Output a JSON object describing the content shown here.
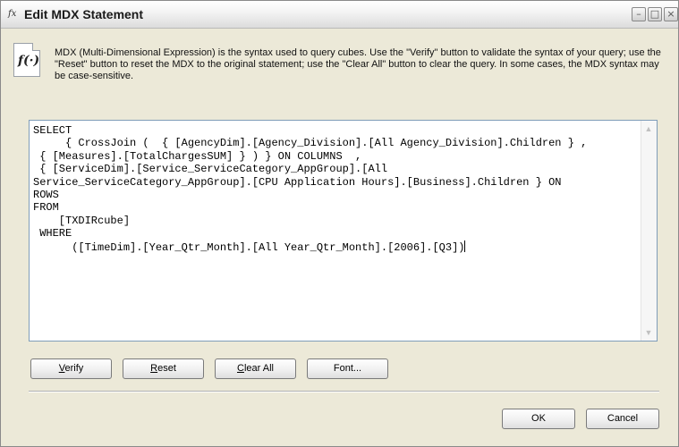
{
  "window": {
    "title": "Edit MDX Statement",
    "controls": {
      "minimize": "–",
      "maximize": "□",
      "close": "×"
    }
  },
  "info": {
    "icon_label": "f(·)",
    "text": "MDX (Multi-Dimensional Expression) is the syntax used to query cubes.  Use the \"Verify\" button to validate the syntax of your query; use the \"Reset\" button to reset the MDX to the original statement; use the \"Clear All\" button to clear the query.  In some cases, the MDX syntax may be case-sensitive."
  },
  "editor": {
    "mdx": "SELECT\n     { CrossJoin (  { [AgencyDim].[Agency_Division].[All Agency_Division].Children } ,\n { [Measures].[TotalChargesSUM] } ) } ON COLUMNS  ,\n { [ServiceDim].[Service_ServiceCategory_AppGroup].[All\nService_ServiceCategory_AppGroup].[CPU Application Hours].[Business].Children } ON\nROWS\nFROM\n    [TXDIRcube]\n WHERE\n      ([TimeDim].[Year_Qtr_Month].[All Year_Qtr_Month].[2006].[Q3])"
  },
  "buttons": {
    "verify": {
      "mnemonic": "V",
      "rest": "erify"
    },
    "reset": {
      "mnemonic": "R",
      "rest": "eset"
    },
    "clear_all": {
      "mnemonic": "C",
      "rest": "lear All"
    },
    "font": "Font...",
    "ok": "OK",
    "cancel": "Cancel"
  },
  "icons": {
    "app": "mdx-app-icon",
    "info": "function-document-icon",
    "scroll_up": "scroll-up-arrow",
    "scroll_down": "scroll-down-arrow"
  }
}
